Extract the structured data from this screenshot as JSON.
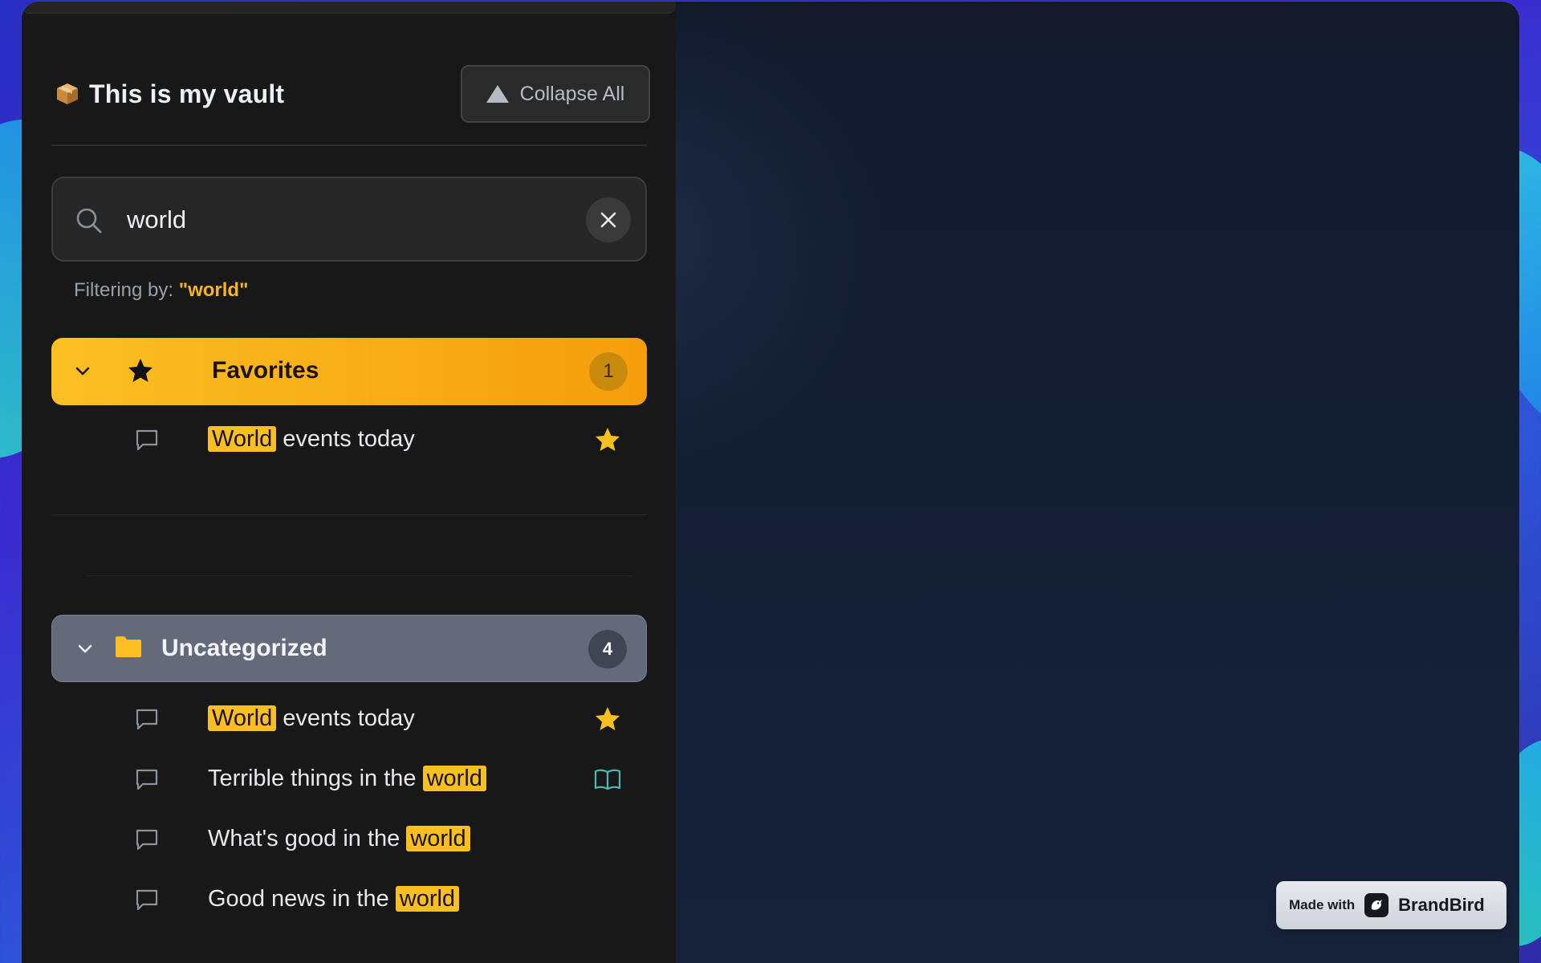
{
  "vault": {
    "title": "This is my vault",
    "collapse_label": "Collapse All"
  },
  "search": {
    "value": "world"
  },
  "filter": {
    "prefix": "Filtering by:",
    "query": "\"world\""
  },
  "favorites": {
    "label": "Favorites",
    "count": "1",
    "items": [
      {
        "highlight": "World",
        "rest": " events today",
        "end_icon": "star-icon"
      }
    ]
  },
  "uncategorized": {
    "label": "Uncategorized",
    "count": "4",
    "items": [
      {
        "prefix": "",
        "highlight": "World",
        "rest": " events today",
        "end_icon": "star-icon"
      },
      {
        "prefix": "Terrible things in the ",
        "highlight": "world",
        "rest": "",
        "end_icon": "book-open-icon"
      },
      {
        "prefix": "What's good in the ",
        "highlight": "world",
        "rest": "",
        "end_icon": ""
      },
      {
        "prefix": "Good news in the ",
        "highlight": "world",
        "rest": "",
        "end_icon": ""
      }
    ]
  },
  "badge": {
    "made_with": "Made with",
    "brand": "BrandBird"
  },
  "colors": {
    "accent": "#f8bf21",
    "favorites_bg": "#f59e0b",
    "uncategorized_bg": "#636b7a",
    "sidebar_bg": "#181818",
    "content_bg": "#141c2e"
  }
}
